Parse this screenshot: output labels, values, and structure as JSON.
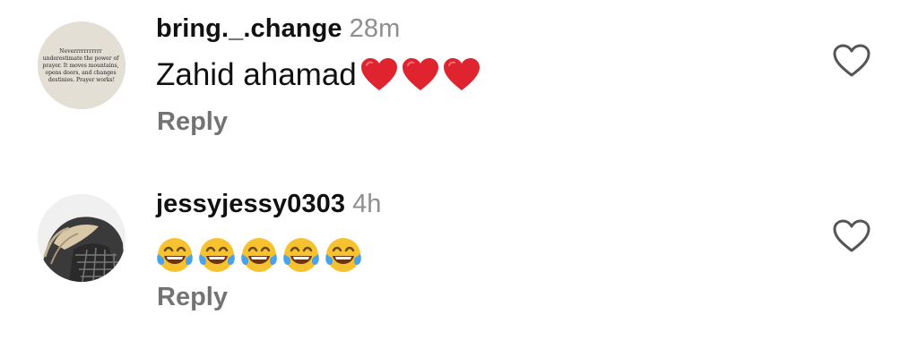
{
  "comments": [
    {
      "username": "bring._.change",
      "time": "28m",
      "text": "Zahid ahamad",
      "emojis": [
        "heart",
        "heart",
        "heart"
      ],
      "reply_label": "Reply",
      "avatar_text": "Neverrrrrrrrrrr underestimate the power of prayer. It moves mountains, opens doors, and changes destinies. Prayer works!"
    },
    {
      "username": "jessyjessy0303",
      "time": "4h",
      "text": "",
      "emojis": [
        "face-with-tears-of-joy",
        "face-with-tears-of-joy",
        "face-with-tears-of-joy",
        "face-with-tears-of-joy",
        "face-with-tears-of-joy"
      ],
      "reply_label": "Reply"
    }
  ],
  "icons": {
    "like": "heart-outline-icon"
  },
  "colors": {
    "secondary_text": "#8e8e8e",
    "reply": "#737373",
    "heart": "#e0242f",
    "emoji_face": "#f7c230"
  }
}
